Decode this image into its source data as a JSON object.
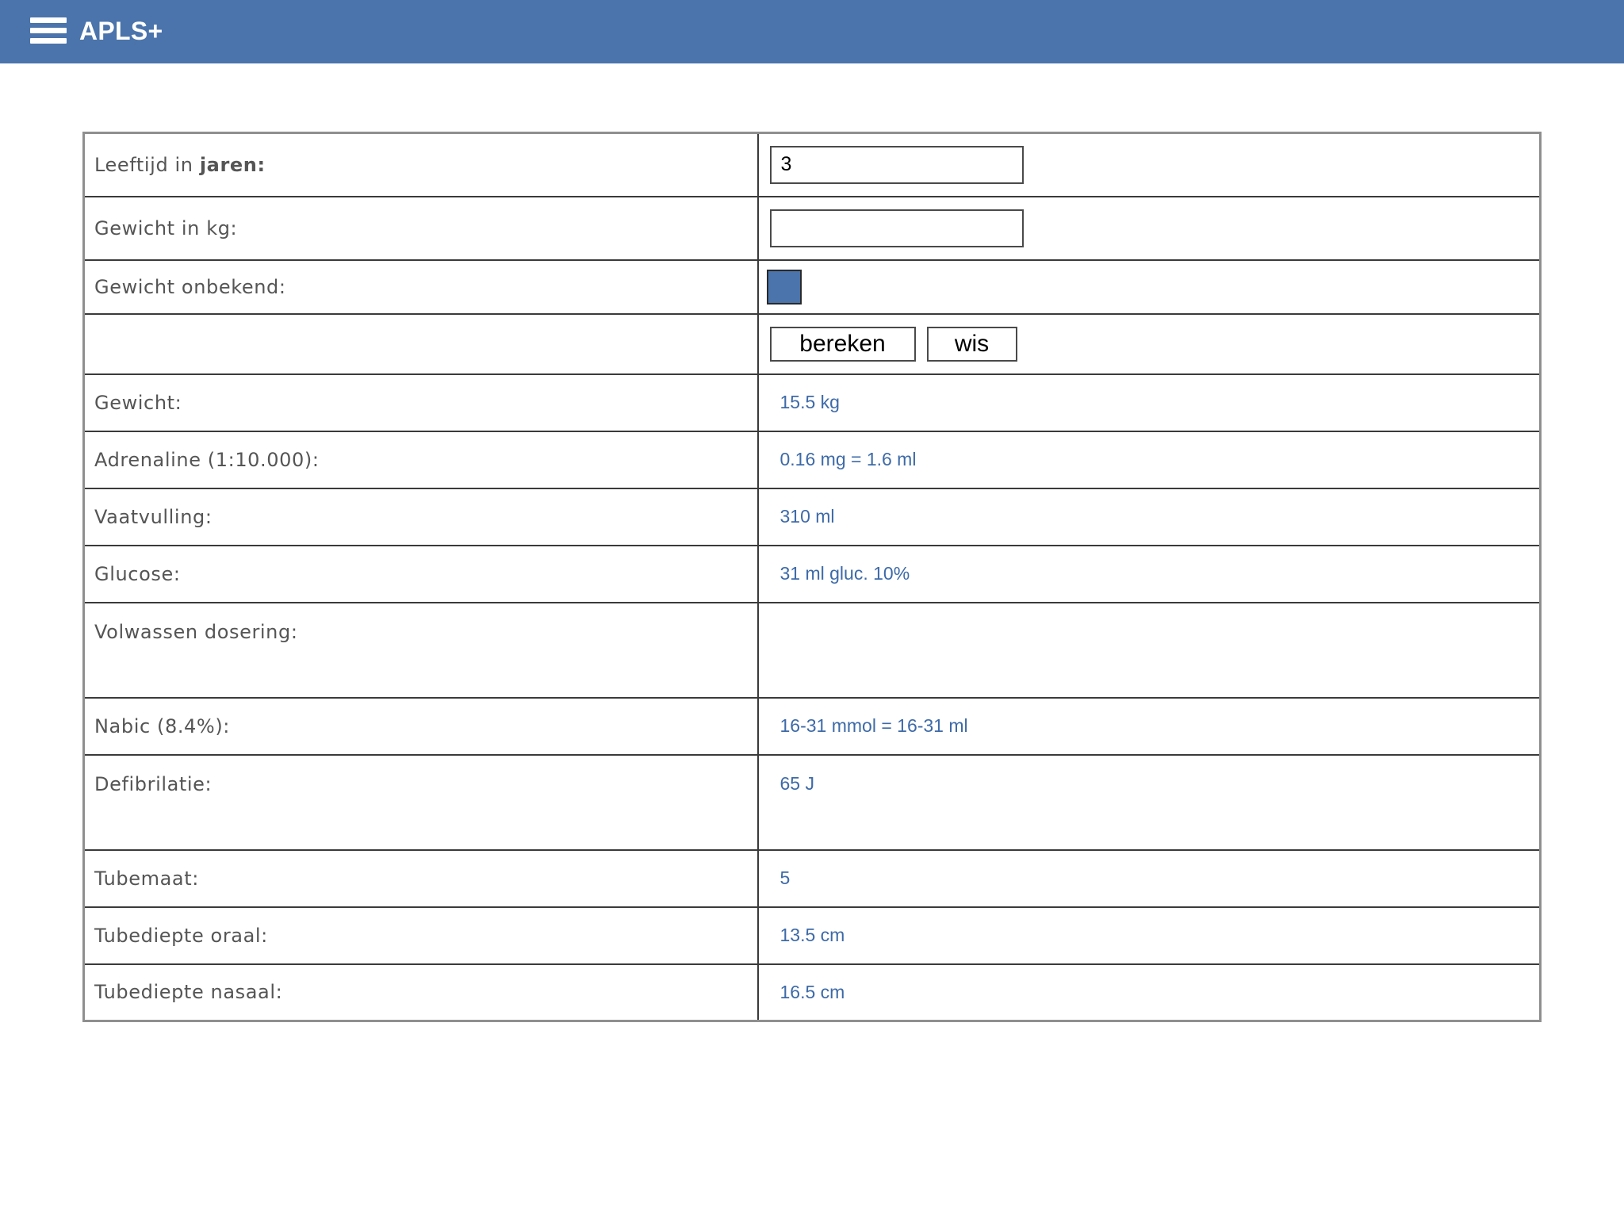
{
  "header": {
    "title": "APLS+"
  },
  "form": {
    "age_label_prefix": "Leeftijd in ",
    "age_label_bold": "jaren:",
    "age_value": "3",
    "weight_label": "Gewicht in kg:",
    "weight_value": "",
    "weight_unknown_label": "Gewicht onbekend:",
    "weight_unknown_checked": true,
    "calc_button": "bereken",
    "clear_button": "wis"
  },
  "results": [
    {
      "label": "Gewicht:",
      "value": "15.5 kg"
    },
    {
      "label": "Adrenaline (1:10.000):",
      "value": "0.16 mg = 1.6 ml"
    },
    {
      "label": "Vaatvulling:",
      "value": "310 ml"
    },
    {
      "label": "Glucose:",
      "value": "31 ml gluc. 10%"
    },
    {
      "label": "Volwassen dosering:",
      "value": ""
    },
    {
      "label": "Nabic (8.4%):",
      "value": "16-31 mmol = 16-31 ml"
    },
    {
      "label": "Defibrilatie:",
      "value": "65 J"
    },
    {
      "label": "Tubemaat:",
      "value": "5"
    },
    {
      "label": "Tubediepte oraal:",
      "value": "13.5 cm"
    },
    {
      "label": "Tubediepte nasaal:",
      "value": "16.5 cm"
    }
  ],
  "colors": {
    "header_bg": "#4a74ab",
    "result_text": "#3d6aa8",
    "label_text": "#555555"
  }
}
